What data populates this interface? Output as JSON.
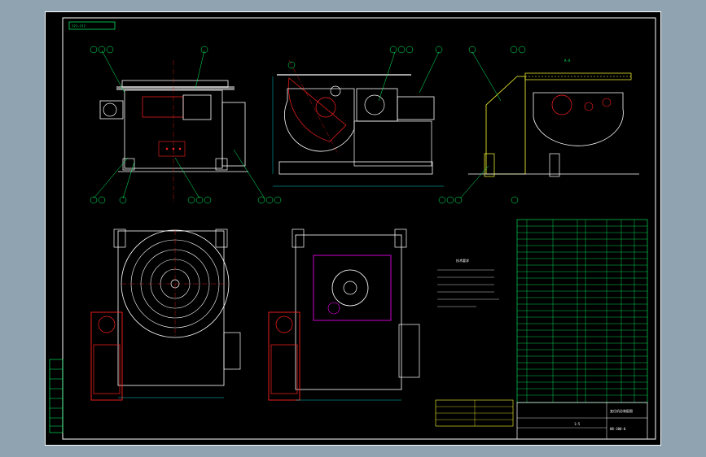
{
  "drawing": {
    "sheet_title": "???-???",
    "view_section": "A-A",
    "notes_heading": "技术要求",
    "title_block": {
      "drawing_name": "变位机总装配图",
      "drawing_no": "HB-300-0",
      "scale": "1:5"
    },
    "colors": {
      "background_outer": "#8fa3b0",
      "sheet": "#000000",
      "outline": "#ffffff",
      "motor": "#ff2020",
      "dimension": "#00ffff",
      "leader": "#00ff66",
      "hidden": "#ff00ff",
      "table": "#00ff66",
      "weld_table": "#ffff33"
    }
  }
}
